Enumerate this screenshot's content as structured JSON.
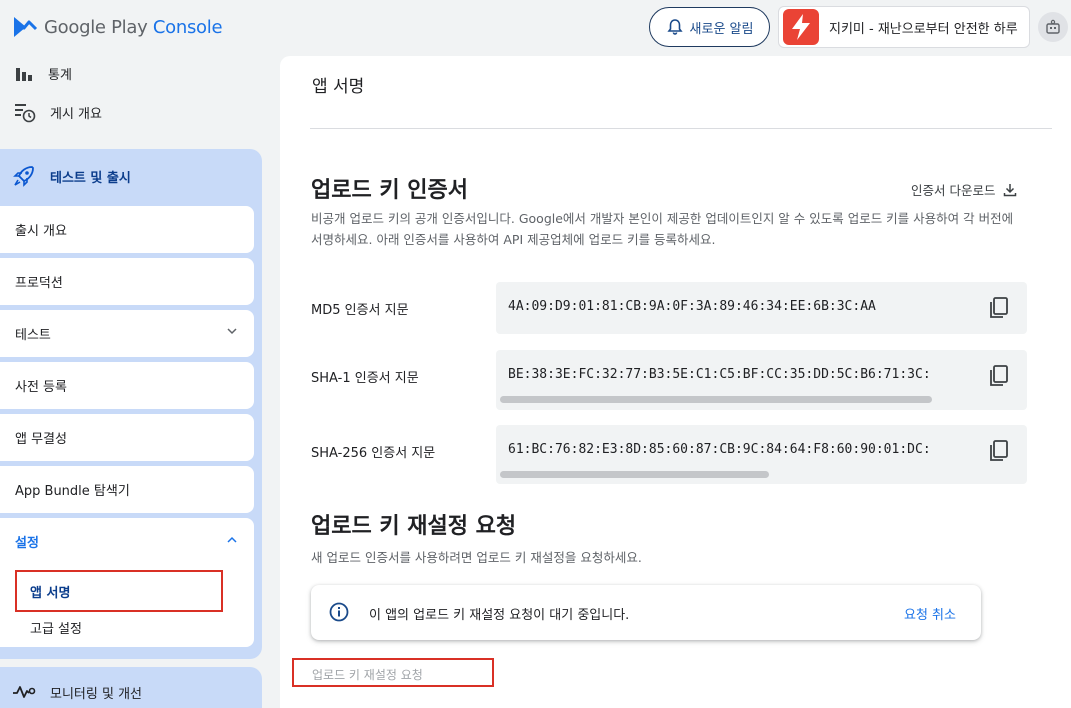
{
  "header": {
    "logo_google_play": "Google Play",
    "logo_console": "Console",
    "notification_label": "새로운 알림",
    "app_name": "지키미 - 재난으로부터 안전한 하루"
  },
  "sidebar": {
    "top_items": [
      {
        "label": "통계",
        "icon": "bar-chart-icon"
      },
      {
        "label": "게시 개요",
        "icon": "publishing-overview-icon"
      }
    ],
    "section_label": "테스트 및 출시",
    "section_items": [
      {
        "label": "출시 개요"
      },
      {
        "label": "프로덕션"
      },
      {
        "label": "테스트",
        "expandable": true
      },
      {
        "label": "사전 등록"
      },
      {
        "label": "앱 무결성"
      },
      {
        "label": "App Bundle 탐색기"
      }
    ],
    "settings_label": "설정",
    "settings_children": [
      {
        "label": "앱 서명",
        "active": true
      },
      {
        "label": "고급 설정"
      }
    ],
    "monitoring_label": "모니터링 및 개선"
  },
  "main": {
    "page_title": "앱 서명",
    "upload_cert": {
      "heading": "업로드 키 인증서",
      "download_label": "인증서 다운로드",
      "description": "비공개 업로드 키의 공개 인증서입니다. Google에서 개발자 본인이 제공한 업데이트인지 알 수 있도록 업로드 키를 사용하여 각 버전에 서명하세요. 아래 인증서를 사용하여 API 제공업체에 업로드 키를 등록하세요.",
      "fingerprints": [
        {
          "label": "MD5 인증서 지문",
          "value": "4A:09:D9:01:81:CB:9A:0F:3A:89:46:34:EE:6B:3C:AA",
          "scroll_fraction": null
        },
        {
          "label": "SHA-1 인증서 지문",
          "value": "BE:38:3E:FC:32:77:B3:5E:C1:C5:BF:CC:35:DD:5C:B6:71:3C:",
          "scroll_fraction": 0.82
        },
        {
          "label": "SHA-256 인증서 지문",
          "value": "61:BC:76:82:E3:8D:85:60:87:CB:9C:84:64:F8:60:90:01:DC:",
          "scroll_fraction": 0.51
        }
      ]
    },
    "reset": {
      "heading": "업로드 키 재설정 요청",
      "description": "새 업로드 인증서를 사용하려면 업로드 키 재설정을 요청하세요.",
      "notice_text": "이 앱의 업로드 키 재설정 요청이 대기 중입니다.",
      "cancel_label": "요청 취소",
      "request_button_label": "업로드 키 재설정 요청"
    }
  },
  "colors": {
    "accent": "#1a73e8",
    "section_bg": "#c8daf8",
    "highlight_box": "#d93025"
  }
}
